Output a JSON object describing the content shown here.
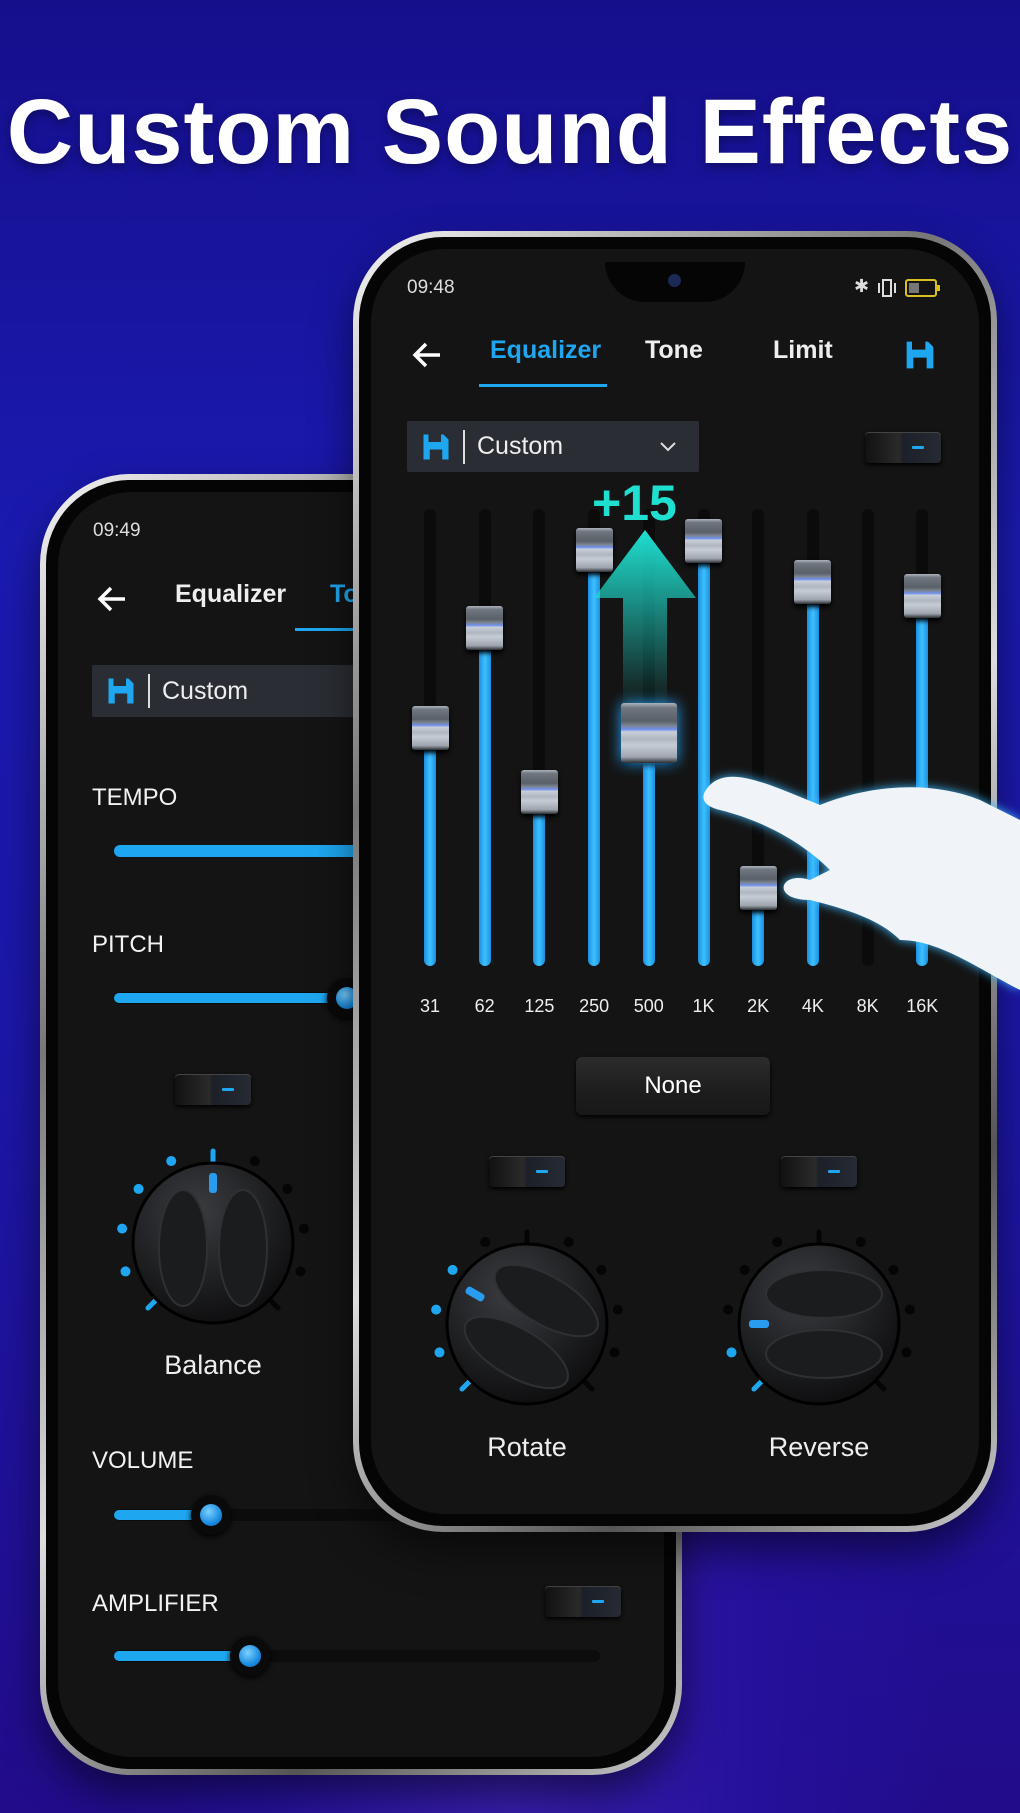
{
  "headline": "Custom Sound Effects",
  "colors": {
    "accent": "#1ea7f0",
    "boost": "#1fe0d0",
    "background": "#1a1ab0"
  },
  "back_phone": {
    "status_time": "09:49",
    "back_icon": "arrow-left-icon",
    "tabs": [
      {
        "label": "Equalizer",
        "active": false
      },
      {
        "label": "To",
        "active": true
      }
    ],
    "preset": {
      "icon": "save-icon",
      "value": "Custom"
    },
    "tempo": {
      "label": "TEMPO"
    },
    "pitch": {
      "label": "PITCH",
      "level": 0.48
    },
    "balance": {
      "label": "Balance",
      "toggle": "off",
      "level": 0.5,
      "lit_ticks": 6,
      "angle_deg": 0
    },
    "volume": {
      "label": "VOLUME",
      "level": 0.2
    },
    "amplifier": {
      "label": "AMPLIFIER",
      "toggle": "off",
      "level": 0.28
    }
  },
  "front_phone": {
    "status_time": "09:48",
    "status_icons": [
      "bluetooth-icon",
      "vibrate-icon",
      "battery-icon"
    ],
    "back_icon": "arrow-left-icon",
    "tabs": [
      {
        "label": "Equalizer",
        "active": true
      },
      {
        "label": "Tone",
        "active": false
      },
      {
        "label": "Limit",
        "active": false
      }
    ],
    "save_icon": "save-icon",
    "preset": {
      "icon": "save-icon",
      "value": "Custom",
      "chevron": "chevron-down-icon"
    },
    "eq_toggle": "off",
    "boost_label": "+15",
    "bands": [
      {
        "label": "31",
        "level": 0.52
      },
      {
        "label": "62",
        "level": 0.74
      },
      {
        "label": "125",
        "level": 0.38
      },
      {
        "label": "250",
        "level": 0.91
      },
      {
        "label": "500",
        "level": 0.51,
        "active": true
      },
      {
        "label": "1K",
        "level": 0.93
      },
      {
        "label": "2K",
        "level": 0.17
      },
      {
        "label": "4K",
        "level": 0.84
      },
      {
        "label": "8K",
        "level": null
      },
      {
        "label": "16K",
        "level": 0.81
      }
    ],
    "reverb_preset": "None",
    "rotate": {
      "label": "Rotate",
      "toggle": "off",
      "level": 0.3,
      "lit_ticks": 4,
      "angle_deg": -60
    },
    "reverse": {
      "label": "Reverse",
      "toggle": "off",
      "level": 0.1,
      "lit_ticks": 2,
      "angle_deg": -90
    }
  }
}
